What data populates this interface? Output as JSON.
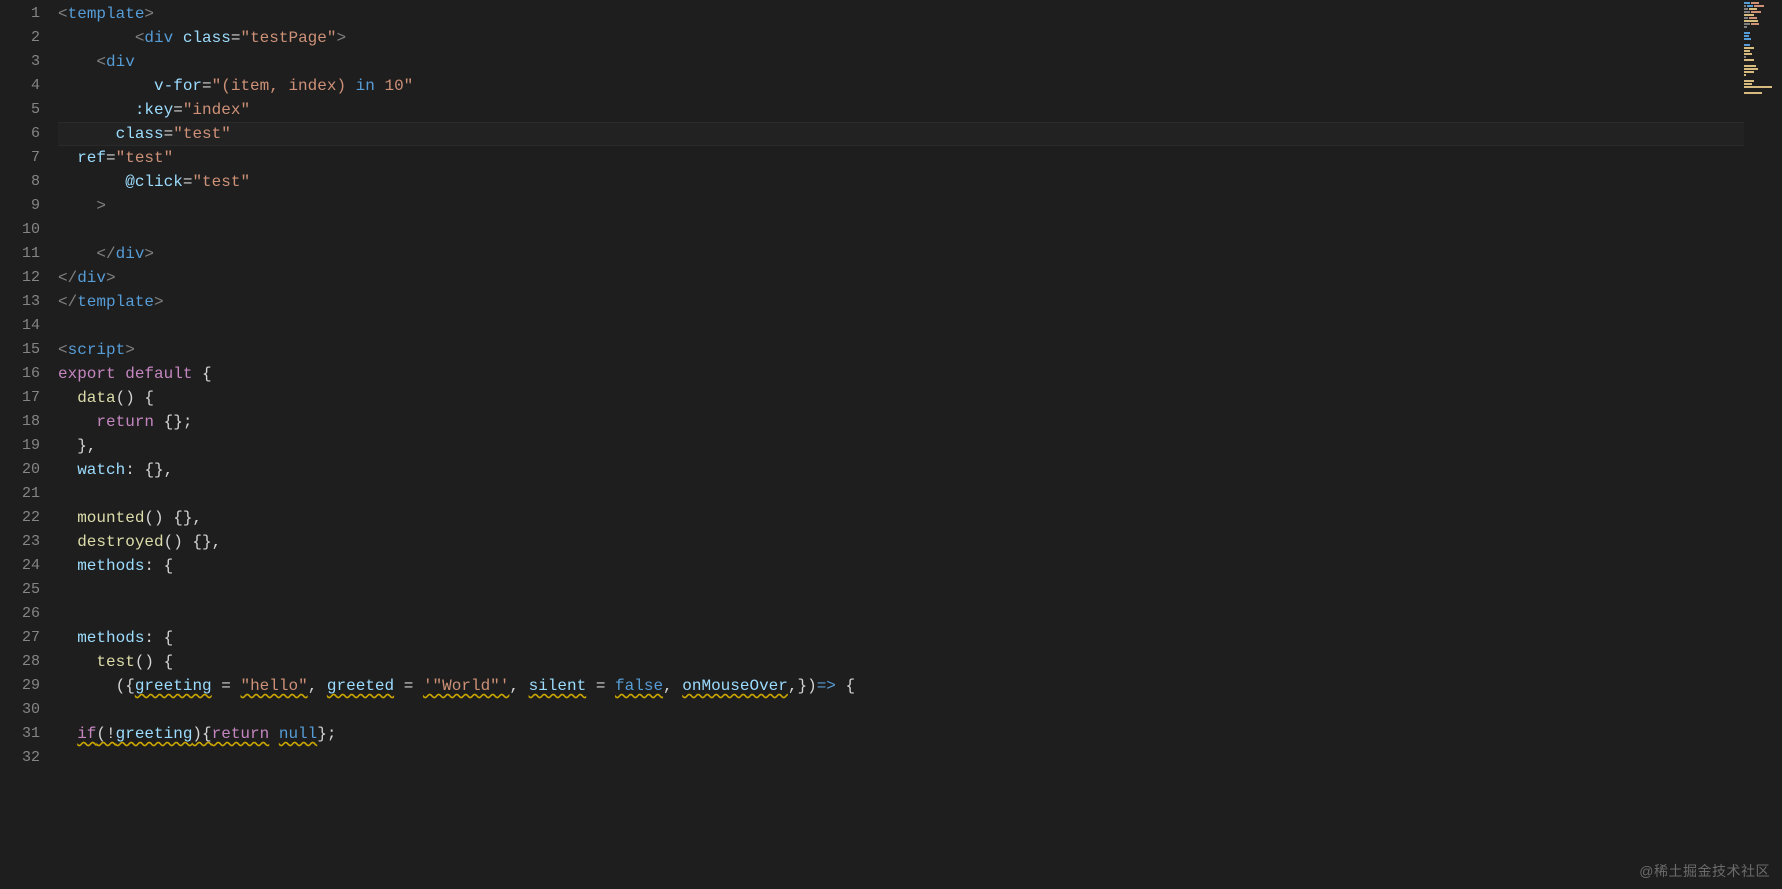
{
  "editor": {
    "current_line": 6,
    "ellipsis": "…",
    "lines": [
      {
        "n": 1,
        "html": "<span class='pun'>&lt;</span><span class='tag'>template</span><span class='pun'>&gt;</span>"
      },
      {
        "n": 2,
        "html": "        <span class='pun'>&lt;</span><span class='tag'>div</span> <span class='attr'>class</span><span class='eq'>=</span><span class='str'>\"testPage\"</span><span class='pun'>&gt;</span>"
      },
      {
        "n": 3,
        "html": "    <span class='pun'>&lt;</span><span class='tag'>div</span>",
        "sq": [
          4,
          5
        ]
      },
      {
        "n": 4,
        "html": "          <span class='attr'>v-for</span><span class='eq'>=</span><span class='str'>\"(item, index) </span><span class='kw'>in</span><span class='str'> 10\"</span>"
      },
      {
        "n": 5,
        "html": "        <span class='attr'>:key</span><span class='eq'>=</span><span class='str'>\"index\"</span>",
        "sq": [
          8,
          12
        ]
      },
      {
        "n": 6,
        "html": "      <span class='attr'>class</span><span class='eq'>=</span><span class='str'>\"test\"</span>"
      },
      {
        "n": 7,
        "html": "  <span class='attr'>ref</span><span class='eq'>=</span><span class='str'>\"test\"</span>",
        "sq": [
          2,
          12
        ]
      },
      {
        "n": 8,
        "html": "       <span class='attr'>@click</span><span class='eq'>=</span><span class='str'>\"test\"</span>"
      },
      {
        "n": 9,
        "html": "    <span class='pun'>&gt;</span>",
        "sq": [
          4,
          5
        ]
      },
      {
        "n": 10,
        "html": " "
      },
      {
        "n": 11,
        "html": "    <span class='pun'>&lt;/</span><span class='tag'>div</span><span class='pun'>&gt;</span>"
      },
      {
        "n": 12,
        "html": "<span class='pun'>&lt;/</span><span class='tag'>div</span><span class='pun'>&gt;</span>"
      },
      {
        "n": 13,
        "html": "<span class='pun'>&lt;/</span><span class='tag'>template</span><span class='pun'>&gt;</span>"
      },
      {
        "n": 14,
        "html": " "
      },
      {
        "n": 15,
        "html": "<span class='pun'>&lt;</span><span class='tag'>script</span><span class='pun'>&gt;</span>"
      },
      {
        "n": 16,
        "html": "<span class='kwp'>export</span> <span class='kwp'>default</span> <span class='op'>{</span>"
      },
      {
        "n": 17,
        "html": "  <span class='fn'>data</span><span class='op'>() {</span>"
      },
      {
        "n": 18,
        "html": "    <span class='kwp'>return</span> <span class='op'>{};</span>"
      },
      {
        "n": 19,
        "html": "  <span class='op'>},</span>"
      },
      {
        "n": 20,
        "html": "  <span class='var'>watch</span><span class='op'>:</span> <span class='op'>{},</span>"
      },
      {
        "n": 21,
        "html": " "
      },
      {
        "n": 22,
        "html": "  <span class='fn'>mounted</span><span class='op'>() {},</span>"
      },
      {
        "n": 23,
        "html": "  <span class='fn'>destroyed</span><span class='op'>() {},</span>"
      },
      {
        "n": 24,
        "html": "  <span class='var'>methods</span><span class='op'>:</span> <span class='op'>{</span>"
      },
      {
        "n": 25,
        "html": " ",
        "sq": [
          0,
          1
        ]
      },
      {
        "n": 26,
        "html": " "
      },
      {
        "n": 27,
        "html": "  <span class='var'>methods</span><span class='op'>:</span> <span class='op'>{</span>"
      },
      {
        "n": 28,
        "html": "    <span class='fn'>test</span><span class='op'>() {</span>",
        "sq": [
          4,
          7
        ]
      },
      {
        "n": 29,
        "html": "      <span class='op'>(</span><span class='op'>{</span><span class='var squiggle'>greeting</span> <span class='op'>=</span> <span class='str squiggle'>\"hello\"</span><span class='op'>,</span> <span class='var squiggle'>greeted</span> <span class='op'>=</span> <span class='str squiggle'>'\"World\"'</span><span class='op'>,</span> <span class='var squiggle'>silent</span> <span class='op'>=</span> <span class='cnst squiggle'>false</span><span class='op'>,</span> <span class='var squiggle'>onMouseOver</span><span class='op'>,}</span><span class='op'>)</span><span class='kw'>=&gt;</span> <span class='op'>{</span>"
      },
      {
        "n": 30,
        "html": " "
      },
      {
        "n": 31,
        "html": "  <span class='kwp squiggle'>if</span><span class='op squiggle'>(!</span><span class='var squiggle'>greeting</span><span class='op squiggle'>){</span><span class='kwp squiggle'>return</span> <span class='cnst squiggle'>null</span><span class='op'>};</span>"
      },
      {
        "n": 32,
        "html": " "
      }
    ]
  },
  "minimap_rows": [
    [
      [
        "mb-b",
        6
      ],
      [
        "mb-o",
        8
      ]
    ],
    [
      [
        "mb-w",
        2
      ],
      [
        "mb-b",
        6
      ],
      [
        "mb-o",
        10
      ]
    ],
    [
      [
        "mb-w",
        4
      ],
      [
        "mb-y",
        8
      ]
    ],
    [
      [
        "mb-w",
        6
      ],
      [
        "mb-o",
        10
      ]
    ],
    [
      [
        "mb-y",
        10
      ]
    ],
    [
      [
        "mb-w",
        4
      ],
      [
        "mb-o",
        8
      ]
    ],
    [
      [
        "mb-y",
        14
      ]
    ],
    [
      [
        "mb-w",
        6
      ],
      [
        "mb-o",
        8
      ]
    ],
    [
      [
        "mb-w",
        3
      ]
    ],
    [],
    [
      [
        "mb-b",
        6
      ]
    ],
    [
      [
        "mb-b",
        5
      ]
    ],
    [
      [
        "mb-b",
        7
      ]
    ],
    [],
    [
      [
        "mb-b",
        6
      ]
    ],
    [
      [
        "mb-y",
        10
      ]
    ],
    [
      [
        "mb-y",
        6
      ]
    ],
    [
      [
        "mb-y",
        8
      ]
    ],
    [
      [
        "mb-w",
        2
      ]
    ],
    [
      [
        "mb-y",
        10
      ]
    ],
    [],
    [
      [
        "mb-y",
        12
      ]
    ],
    [
      [
        "mb-y",
        14
      ]
    ],
    [
      [
        "mb-y",
        10
      ]
    ],
    [
      [
        "mb-y",
        2
      ]
    ],
    [],
    [
      [
        "mb-y",
        10
      ]
    ],
    [
      [
        "mb-y",
        8
      ]
    ],
    [
      [
        "mb-y",
        28
      ]
    ],
    [],
    [
      [
        "mb-y",
        18
      ]
    ]
  ],
  "watermark": "@稀土掘金技术社区"
}
